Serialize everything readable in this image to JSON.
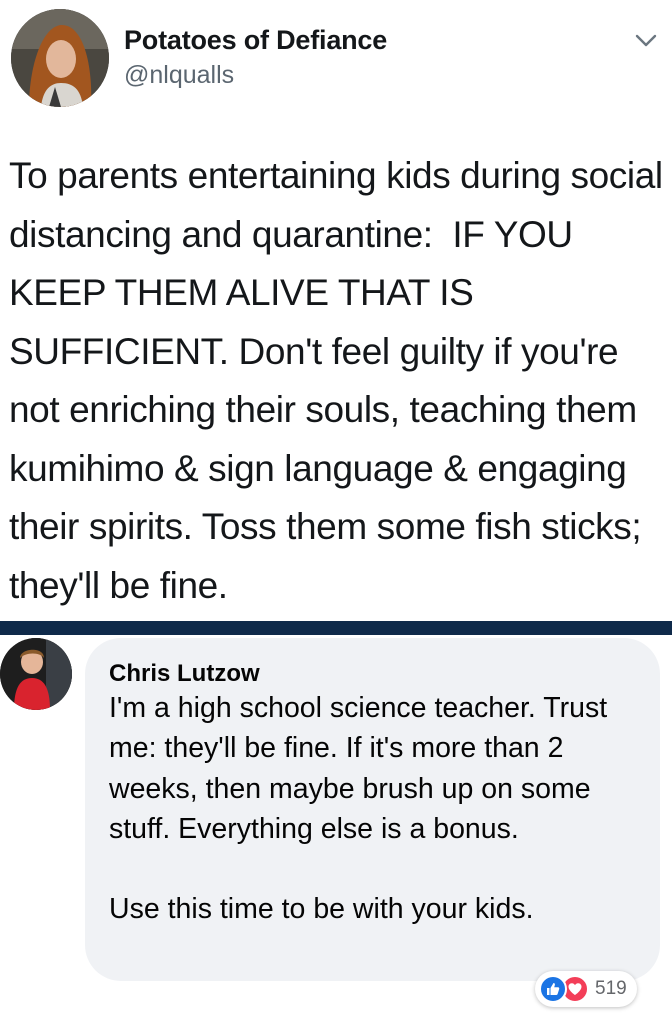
{
  "tweet": {
    "display_name": "Potatoes of Defiance",
    "handle": "@nlqualls",
    "text": "To parents entertaining kids during social distancing and quarantine:  IF YOU KEEP THEM ALIVE THAT IS SUFFICIENT. Don't feel guilty if you're not enriching their souls, teaching them kumihimo & sign language & engaging their spirits. Toss them some fish sticks; they'll be fine.",
    "menu_icon": "chevron-down-icon"
  },
  "comment": {
    "author": "Chris Lutzow",
    "text": "I'm a high school science teacher. Trust me: they'll be fine. If it's more than 2 weeks, then maybe brush up on some stuff. Everything else is a bonus.\n\nUse this time to be with your kids.",
    "reactions": {
      "icons": [
        "like-icon",
        "heart-icon"
      ],
      "count": "519"
    }
  },
  "colors": {
    "divider": "#0f2a4a",
    "bubble": "#f0f2f5",
    "like": "#1b74e4",
    "love": "#f33e58",
    "handle": "#5b6670"
  }
}
